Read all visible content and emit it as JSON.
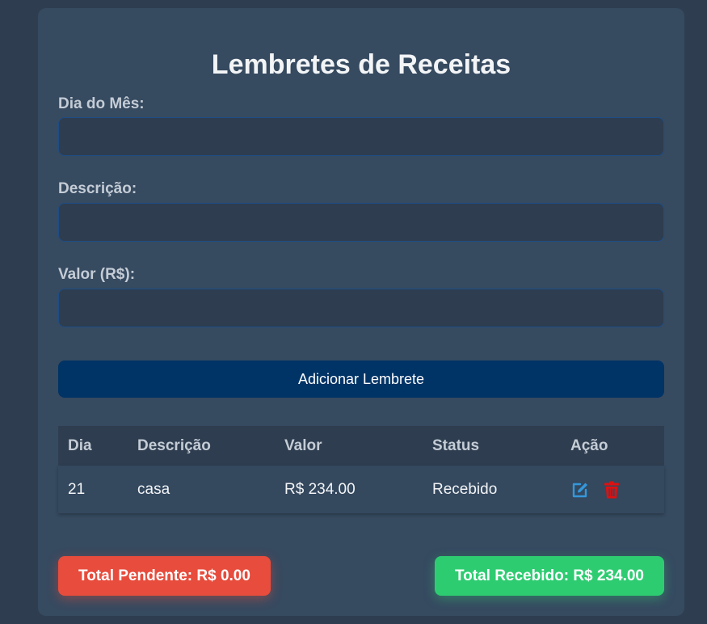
{
  "page": {
    "title": "Lembretes de Receitas"
  },
  "form": {
    "day_label": "Dia do Mês:",
    "day_value": "",
    "description_label": "Descrição:",
    "description_value": "",
    "amount_label": "Valor (R$):",
    "amount_value": "",
    "add_button_label": "Adicionar Lembrete"
  },
  "table": {
    "headers": [
      "Dia",
      "Descrição",
      "Valor",
      "Status",
      "Ação"
    ],
    "rows": [
      {
        "day": "21",
        "description": "casa",
        "amount": "R$ 234.00",
        "status": "Recebido",
        "actions": [
          "edit-icon",
          "trash-icon"
        ]
      }
    ]
  },
  "totals": {
    "pending_label": "Total Pendente: R$ 0.00",
    "received_label": "Total Recebido: R$ 234.00"
  },
  "colors": {
    "background": "#2e3e50",
    "card": "#364a60",
    "primary_button": "#003366",
    "edit_icon": "#3498db",
    "delete_icon": "#e01010",
    "pending": "#e74c3c",
    "received": "#2ecc71"
  }
}
